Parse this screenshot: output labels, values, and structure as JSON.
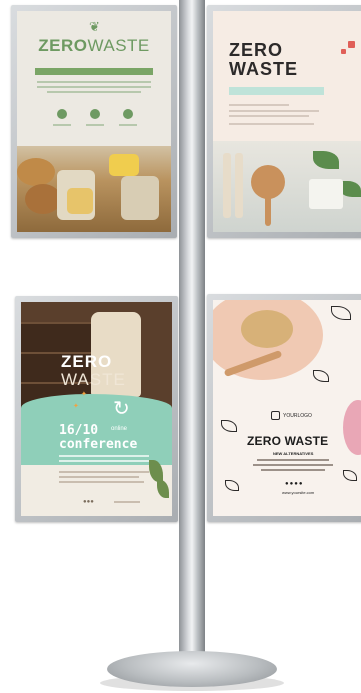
{
  "posters": {
    "top_left": {
      "title_bold": "ZERO",
      "title_light": "WASTE"
    },
    "top_right": {
      "title_line1": "ZERO",
      "title_line2": "WASTE"
    },
    "bottom_left": {
      "title_line1": "ZERO",
      "title_line2": "WASTE",
      "date": "16/10",
      "online": "online",
      "conference": "conference"
    },
    "bottom_right": {
      "logo": "YOURLOGO",
      "title": "ZERO WASTE",
      "subtitle": "NEW ALTERNATIVES",
      "dots": "●●●●",
      "website": "www.yoursite.com"
    }
  },
  "colors": {
    "green": "#6e9a62",
    "mint": "#8fcfb9",
    "pole_silver": "#c8cbce",
    "dark_text": "#2c2a2a"
  }
}
